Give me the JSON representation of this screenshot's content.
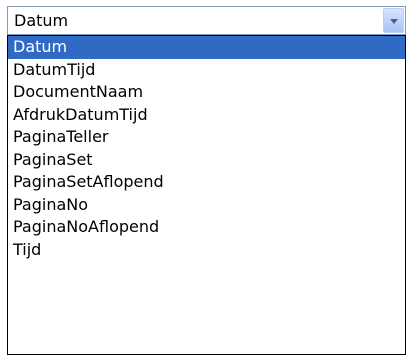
{
  "combo": {
    "value": "Datum",
    "icon": "chevron-down-icon"
  },
  "dropdown": {
    "selected_index": 0,
    "options": [
      {
        "label": "Datum"
      },
      {
        "label": "DatumTijd"
      },
      {
        "label": "DocumentNaam"
      },
      {
        "label": "AfdrukDatumTijd"
      },
      {
        "label": "PaginaTeller"
      },
      {
        "label": "PaginaSet"
      },
      {
        "label": "PaginaSetAflopend"
      },
      {
        "label": "PaginaNo"
      },
      {
        "label": "PaginaNoAflopend"
      },
      {
        "label": "Tijd"
      }
    ]
  },
  "colors": {
    "selection_background": "#316ac5",
    "selection_text": "#ffffff",
    "combo_border": "#7f9db9",
    "list_border": "#000000"
  }
}
